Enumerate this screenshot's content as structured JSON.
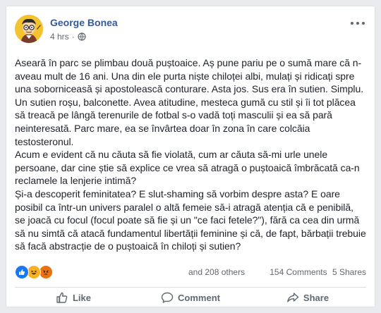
{
  "post": {
    "author": "George Bonea",
    "time": "4 hrs",
    "separator": "·",
    "privacy_icon": "globe-icon",
    "paragraphs": [
      "Aseară în parc se plimbau două puștoaice. Aș pune pariu pe o sumă mare că n-aveau mult de 16 ani. Una din ele purta niște chiloței albi, mulați și ridicați spre una soborniceasă și apostolească conturare. Asta jos. Sus era în sutien. Simplu. Un sutien roșu, balconette. Avea atitudine, mesteca gumă cu stil și îi tot plăcea să treacă pe lângă terenurile de fotbal s-o vadă toți masculii și ea să pară neinteresată. Parc mare, ea se învârtea doar în zona în care colcăia testosteronul.",
      "Acum e evident că nu căuta să fie violată, cum ar căuta să-mi urle unele persoane, dar cine știe să explice ce vrea să atragă o puștoaică îmbrăcată ca-n reclamele la lenjerie intimă?",
      "Și-a descoperit feminitatea? E slut-shaming să vorbim despre asta? E oare posibil ca într-un univers paralel o altă femeie să-i atragă atenția că e penibilă, se joacă cu focul (focul poate să fie și un \"ce faci fetele?\"), fără ca cea din urmă să nu simtă că atacă fundamentul libertății feminine și că, de fapt, bărbații trebuie să facă abstracție de o puștoaică în chiloți și sutien?"
    ]
  },
  "stats": {
    "reaction_icons": [
      "like-reaction-icon",
      "haha-reaction-icon",
      "angry-reaction-icon"
    ],
    "others": "and 208 others",
    "comments": "154 Comments",
    "shares": "5 Shares"
  },
  "actions": {
    "like": "Like",
    "comment": "Comment",
    "share": "Share"
  },
  "colors": {
    "author": "#365899",
    "text": "#1d2129",
    "meta": "#616770",
    "like_reaction": "#1877f2",
    "haha_reaction": "#f7b125",
    "angry_reaction": "#e9710f",
    "background": "#e9ebee"
  }
}
